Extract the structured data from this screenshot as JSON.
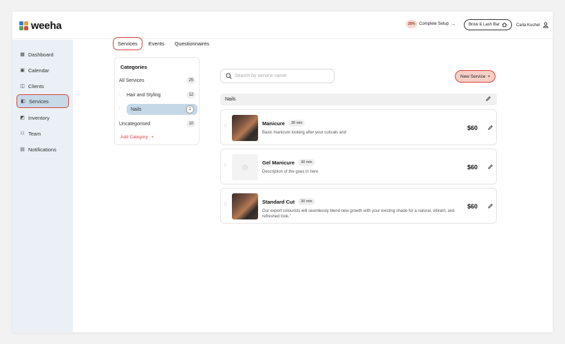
{
  "app": {
    "logo_text": "weeha",
    "brand_colors": [
      "#3d7fc9",
      "#e9a33a",
      "#5aa05a",
      "#d94a3a"
    ]
  },
  "topbar": {
    "setup_percent": "25%",
    "setup_label": "Complete Setup",
    "setup_arrow": "→",
    "business_name": "Brow & Lash Bar",
    "business_icon": "home-icon",
    "user_name": "Carla Kuchel",
    "user_icon": "user-icon"
  },
  "sidebar": {
    "items": [
      {
        "label": "Dashboard",
        "icon": "dashboard-icon",
        "glyph": "▦"
      },
      {
        "label": "Calendar",
        "icon": "calendar-icon",
        "glyph": "▣"
      },
      {
        "label": "Clients",
        "icon": "clients-icon",
        "glyph": "◫"
      },
      {
        "label": "Services",
        "icon": "services-icon",
        "glyph": "◧"
      },
      {
        "label": "Inventory",
        "icon": "inventory-icon",
        "glyph": "◩"
      },
      {
        "label": "Team",
        "icon": "team-icon",
        "glyph": "⚇"
      },
      {
        "label": "Notifications",
        "icon": "notifications-icon",
        "glyph": "▤"
      }
    ],
    "active": "Services"
  },
  "tabs": [
    {
      "label": "Services"
    },
    {
      "label": "Events"
    },
    {
      "label": "Questionnaires"
    }
  ],
  "categories": {
    "title": "Categories",
    "items": [
      {
        "name": "All Services",
        "count": "25"
      },
      {
        "name": "Hair and Styling",
        "count": "12"
      },
      {
        "name": "Nails",
        "count": "1"
      },
      {
        "name": "Uncategorised",
        "count": "10"
      }
    ],
    "add_label": "Add Category",
    "add_symbol": "+"
  },
  "search": {
    "placeholder": "Search by service name"
  },
  "new_service": {
    "label": "New Service",
    "symbol": "+"
  },
  "group": {
    "name": "Nails"
  },
  "services": [
    {
      "name": "Manicure",
      "duration": "30 min",
      "description": "Basic manicure looking after your cuticals and",
      "price": "$60"
    },
    {
      "name": "Gel Manicure",
      "duration": "30 min",
      "description": "Description of the  goes in here",
      "price": "$60"
    },
    {
      "name": "Standard Cut",
      "duration": "30 min",
      "description": "Our expert colourists will seamlessly blend new growth with your existing shade for a natural, vibrant, and refreshed look.\"",
      "price": "$60"
    }
  ]
}
